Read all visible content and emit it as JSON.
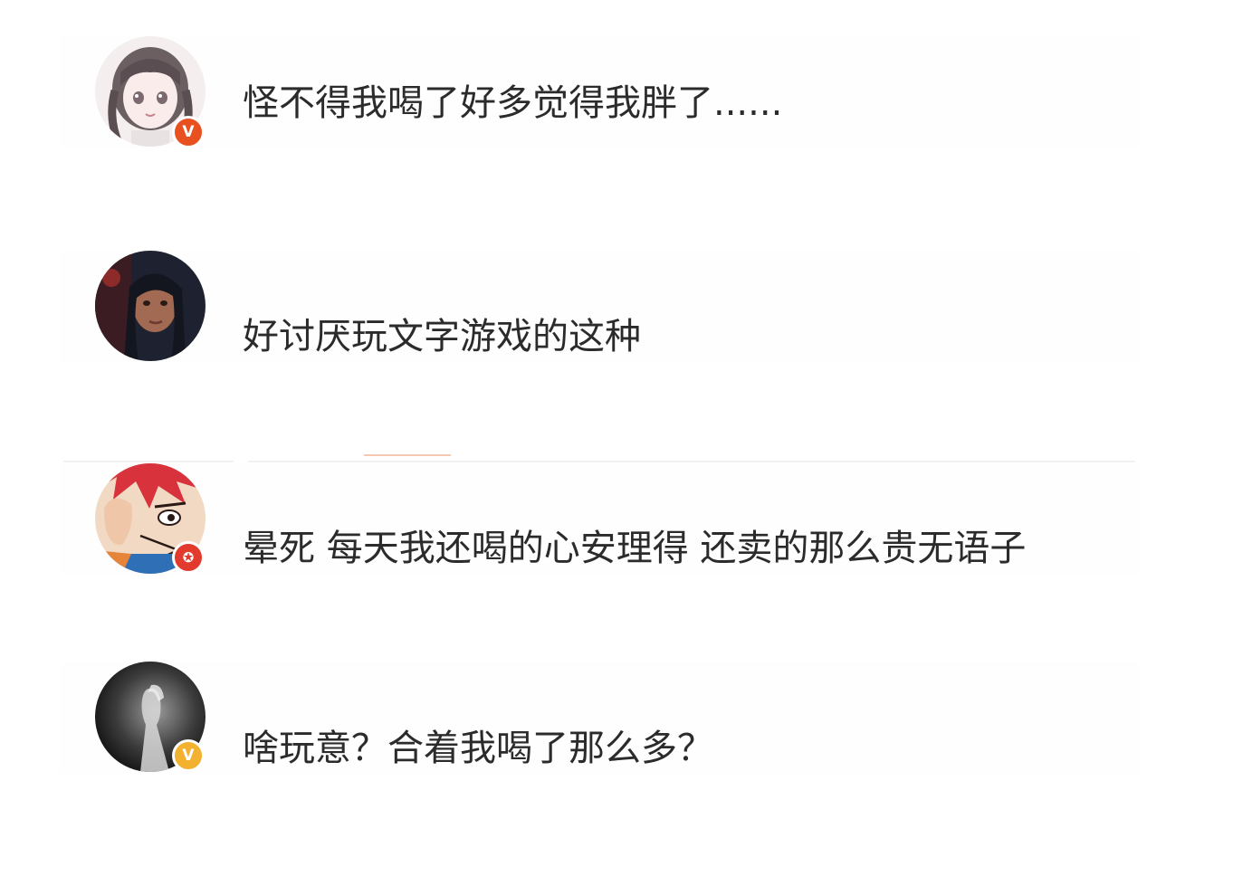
{
  "comments": [
    {
      "text": "怪不得我喝了好多觉得我胖了......",
      "avatar": "anime-girl-braids-avatar",
      "badge": {
        "icon": "verified-v-icon",
        "glyph": "V",
        "color": "#e8501f"
      }
    },
    {
      "text": "好讨厌玩文字游戏的这种",
      "avatar": "woman-portrait-dark-avatar",
      "badge": null
    },
    {
      "text": "晕死 每天我还喝的心安理得 还卖的那么贵无语子",
      "avatar": "anime-red-hair-character-avatar",
      "badge": {
        "icon": "star-badge-icon",
        "glyph": "✪",
        "color": "#e23a2c"
      }
    },
    {
      "text": "啥玩意？合着我喝了那么多？",
      "avatar": "grayscale-figure-avatar",
      "badge": {
        "icon": "verified-v-icon",
        "glyph": "V",
        "color": "#f2b12f"
      }
    }
  ],
  "colors": {
    "background": "#ffffff",
    "text": "#2b2b2b",
    "divider": "#f1f1f1",
    "divider_accent": "#f6c8b2"
  }
}
